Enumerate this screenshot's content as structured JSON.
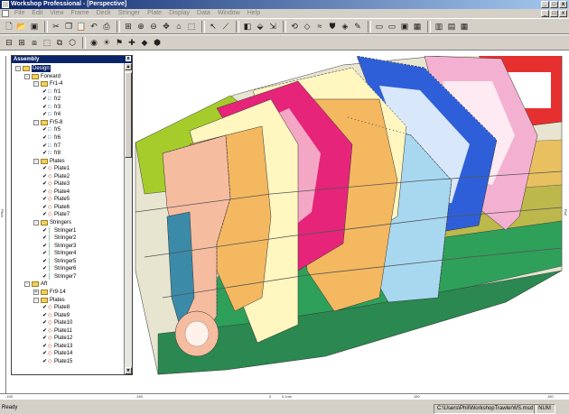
{
  "window": {
    "title": "Workshop Professional - [Perspective]",
    "min": "_",
    "max": "□",
    "close": "x"
  },
  "menu": [
    "File",
    "Edit",
    "View",
    "Frame",
    "Deck",
    "Stringer",
    "Plate",
    "Display",
    "Data",
    "Window",
    "Help"
  ],
  "assembly": {
    "title": "Assembly",
    "close_label": "x",
    "rows": [
      {
        "label": "Design",
        "kind": "folder",
        "pm": "-",
        "depth": 0,
        "selected": true
      },
      {
        "label": "Forward",
        "kind": "folder",
        "pm": "-",
        "depth": 1
      },
      {
        "label": "Fr1-4",
        "kind": "folder",
        "pm": "-",
        "depth": 2
      },
      {
        "label": "fr1",
        "kind": "frame",
        "depth": 3
      },
      {
        "label": "fr2",
        "kind": "frame",
        "depth": 3
      },
      {
        "label": "fr3",
        "kind": "frame",
        "depth": 3
      },
      {
        "label": "fr4",
        "kind": "frame",
        "depth": 3
      },
      {
        "label": "Fr5-8",
        "kind": "folder",
        "pm": "-",
        "depth": 2
      },
      {
        "label": "fr5",
        "kind": "frame",
        "depth": 3
      },
      {
        "label": "fr6",
        "kind": "frame",
        "depth": 3
      },
      {
        "label": "fr7",
        "kind": "frame",
        "depth": 3
      },
      {
        "label": "fr8",
        "kind": "frame",
        "depth": 3
      },
      {
        "label": "Plates",
        "kind": "folder",
        "pm": "-",
        "depth": 2
      },
      {
        "label": "Plate1",
        "kind": "plate",
        "depth": 3
      },
      {
        "label": "Plate2",
        "kind": "plate",
        "depth": 3
      },
      {
        "label": "Plate3",
        "kind": "plate",
        "depth": 3
      },
      {
        "label": "Plate4",
        "kind": "plate",
        "depth": 3
      },
      {
        "label": "Plate5",
        "kind": "plate",
        "depth": 3
      },
      {
        "label": "Plate6",
        "kind": "plate",
        "depth": 3
      },
      {
        "label": "Plate7",
        "kind": "plate",
        "depth": 3
      },
      {
        "label": "Stringers",
        "kind": "folder",
        "pm": "-",
        "depth": 2
      },
      {
        "label": "Stringer1",
        "kind": "stringer",
        "depth": 3
      },
      {
        "label": "Stringer2",
        "kind": "stringer",
        "depth": 3
      },
      {
        "label": "Stringer3",
        "kind": "stringer",
        "depth": 3
      },
      {
        "label": "Stringer4",
        "kind": "stringer",
        "depth": 3
      },
      {
        "label": "Stringer5",
        "kind": "stringer",
        "depth": 3
      },
      {
        "label": "Stringer6",
        "kind": "stringer",
        "depth": 3
      },
      {
        "label": "Stringer7",
        "kind": "stringer",
        "depth": 3
      },
      {
        "label": "Aft",
        "kind": "folder",
        "pm": "-",
        "depth": 1
      },
      {
        "label": "Fr9-14",
        "kind": "folder",
        "pm": "+",
        "depth": 2
      },
      {
        "label": "Plates",
        "kind": "folder",
        "pm": "-",
        "depth": 2
      },
      {
        "label": "Plate8",
        "kind": "plate",
        "depth": 3
      },
      {
        "label": "Plate9",
        "kind": "plate",
        "depth": 3
      },
      {
        "label": "Plate10",
        "kind": "plate",
        "depth": 3
      },
      {
        "label": "Plate11",
        "kind": "plate",
        "depth": 3
      },
      {
        "label": "Plate12",
        "kind": "plate",
        "depth": 3
      },
      {
        "label": "Plate13",
        "kind": "plate",
        "depth": 3
      },
      {
        "label": "Plate14",
        "kind": "plate",
        "depth": 3
      },
      {
        "label": "Plate15",
        "kind": "plate",
        "depth": 3
      }
    ]
  },
  "rulers": {
    "left": "Pitch",
    "right": "Roll",
    "bottom_left": "-150",
    "bottom_mid": "0",
    "bottom_mid_label": "0.1ms",
    "bottom_right": "150"
  },
  "status": {
    "left": "Ready",
    "file": "C:\\Users\\Phil\\WorkshopTrawlerWS.msd",
    "num": "NUM"
  },
  "colors": {
    "titlebar": "#0a246a",
    "lime": "#a5cc2a",
    "pink": "#e6247a",
    "cream": "#fff6c0",
    "blue": "#2f5fd8",
    "lightblue": "#a8d8f0",
    "lightpink": "#f4b0d0",
    "red": "#e63030",
    "green": "#2ea05a",
    "olive": "#bdb84c",
    "orange": "#f4b860",
    "salmon": "#f6bca0",
    "teal": "#3a8aa8"
  }
}
